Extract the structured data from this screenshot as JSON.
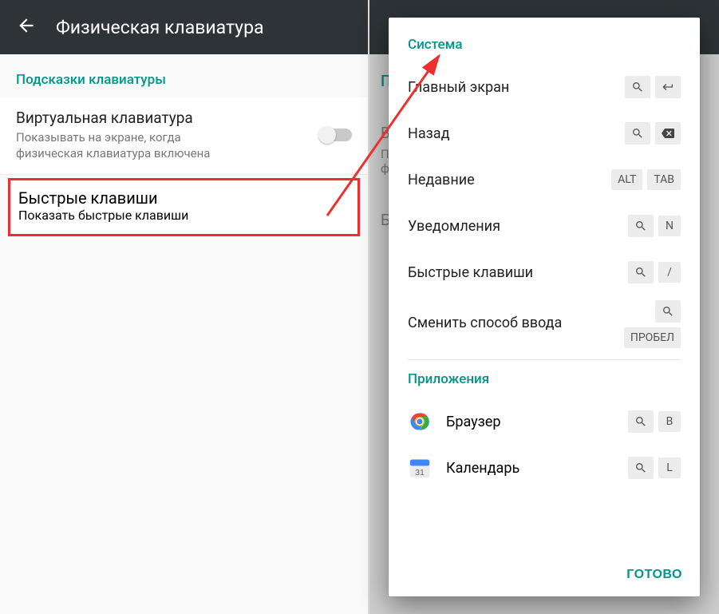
{
  "left": {
    "title": "Физическая клавиатура",
    "section": "Подсказки клавиатуры",
    "virtual": {
      "title": "Виртуальная клавиатура",
      "sub": "Показывать на экране, когда физическая клавиатура включена"
    },
    "shortcut": {
      "title": "Быстрые клавиши",
      "sub": "Показать быстрые клавиши"
    }
  },
  "backdrop": {
    "section_letter": "П",
    "row1": "В",
    "row2a": "П",
    "row2b": "ф",
    "row3": "Б"
  },
  "dialog": {
    "section1": "Система",
    "rows": [
      {
        "label": "Главный экран"
      },
      {
        "label": "Назад"
      },
      {
        "label": "Недавние",
        "k1": "ALT",
        "k2": "TAB"
      },
      {
        "label": "Уведомления",
        "k2": "N"
      },
      {
        "label": "Быстрые клавиши",
        "k2": "/"
      },
      {
        "label": "Сменить способ ввода",
        "k2": "ПРОБЕЛ"
      }
    ],
    "section2": "Приложения",
    "apps": [
      {
        "label": "Браузер",
        "k2": "B",
        "day": ""
      },
      {
        "label": "Календарь",
        "k2": "L",
        "day": "31"
      }
    ],
    "done": "ГОТОВО"
  }
}
